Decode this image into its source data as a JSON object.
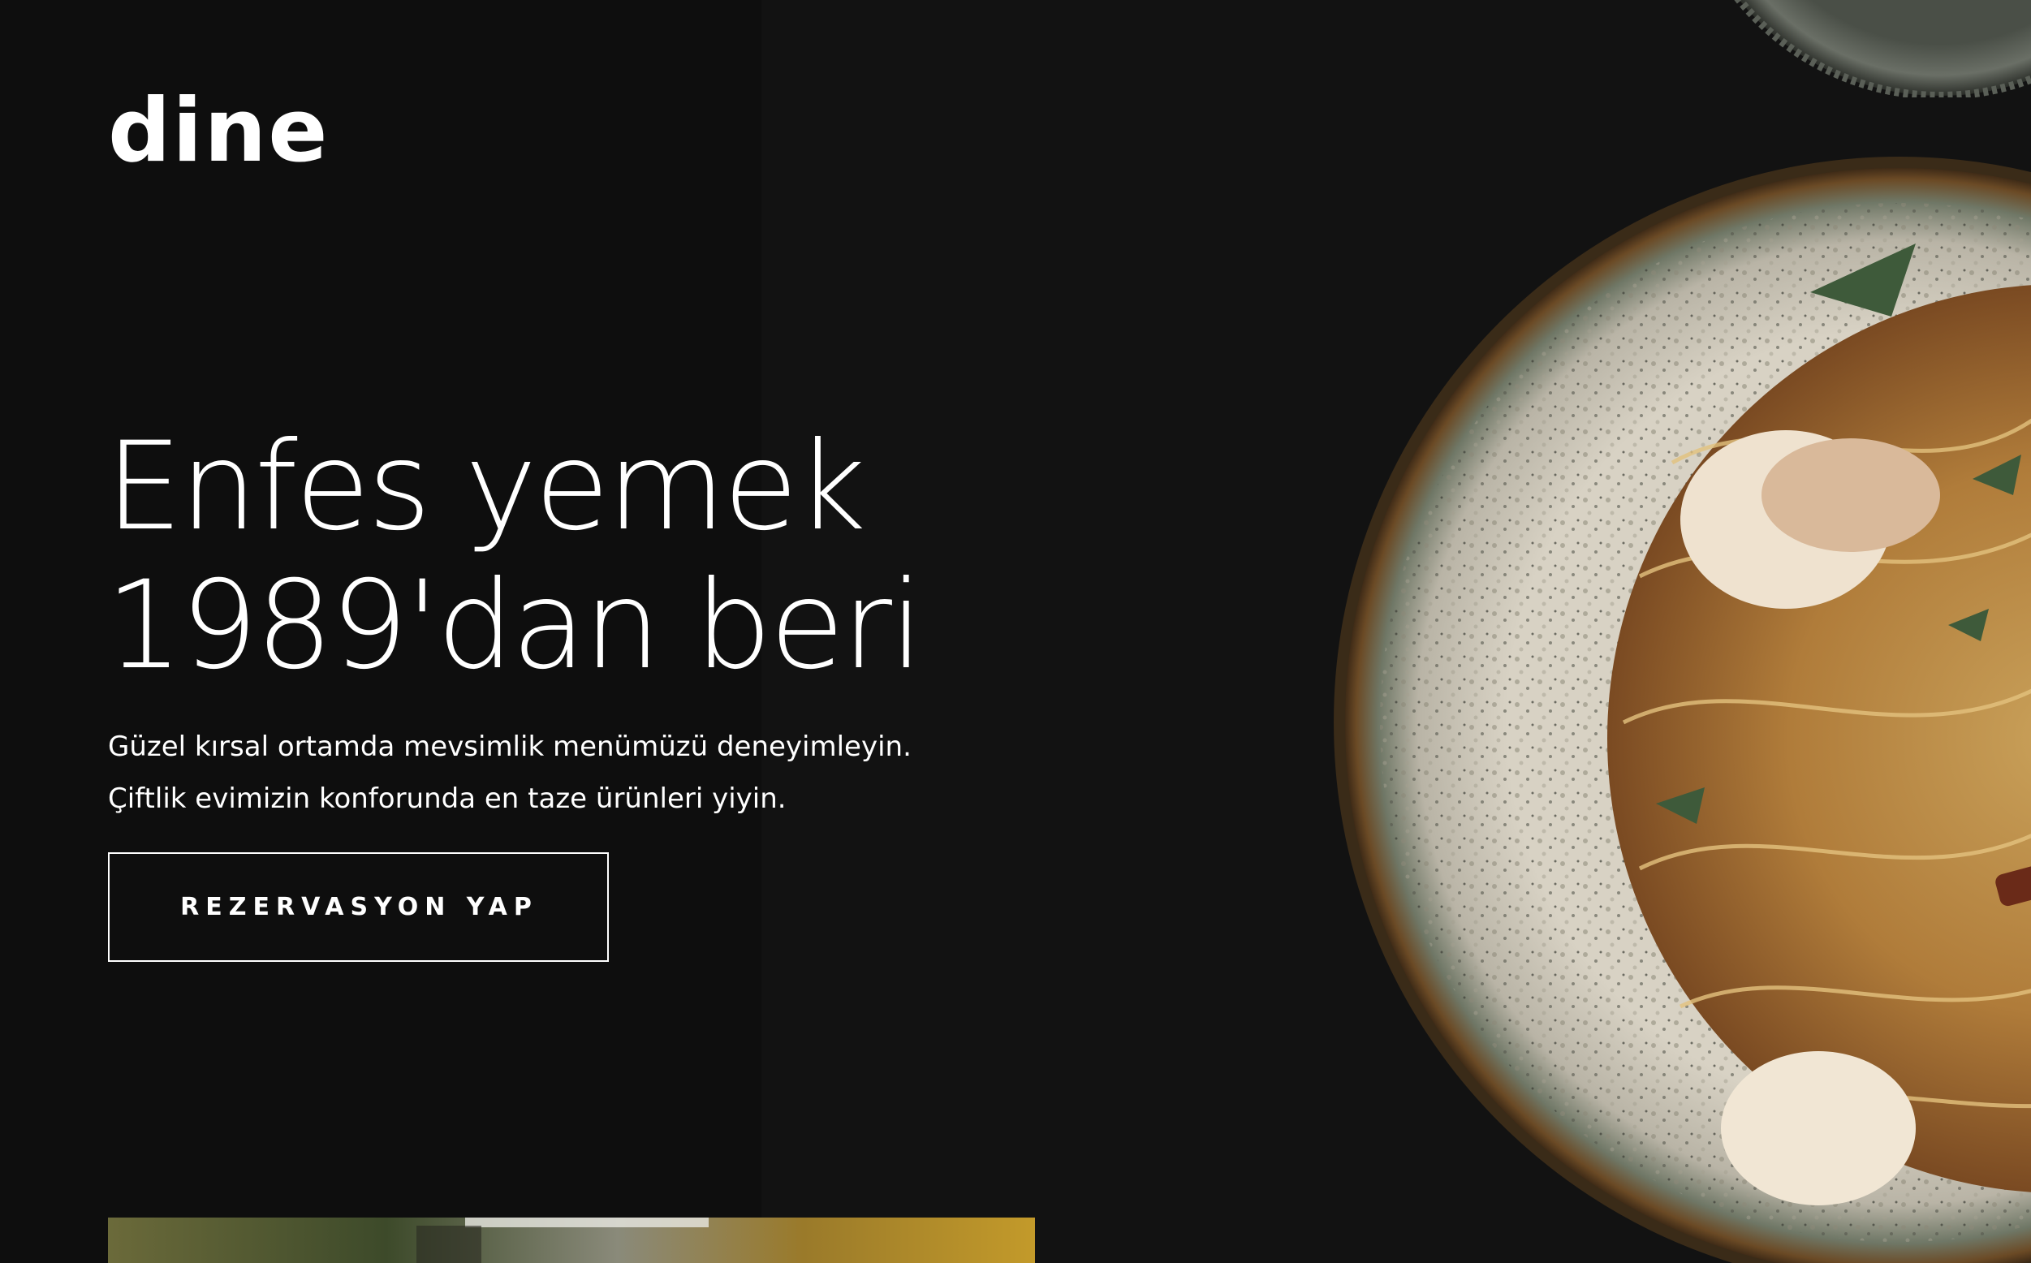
{
  "brand": {
    "logo_text": "dine"
  },
  "hero": {
    "headline_line1": "Enfes yemek",
    "headline_line2": "1989'dan beri",
    "subtext_line1": "Güzel kırsal ortamda mevsimlik menümüzü deneyimleyin.",
    "subtext_line2": "Çiftlik evimizin konforunda en taze ürünleri yiyin.",
    "cta_label": "REZERVASYON YAP"
  },
  "colors": {
    "background": "#121212",
    "left_panel": "#0e0e0e",
    "text": "#ffffff"
  },
  "images": {
    "hero_image": "pasta-plate-image",
    "top_image": "plate-rim-image",
    "bottom_image": "countryside-image"
  }
}
